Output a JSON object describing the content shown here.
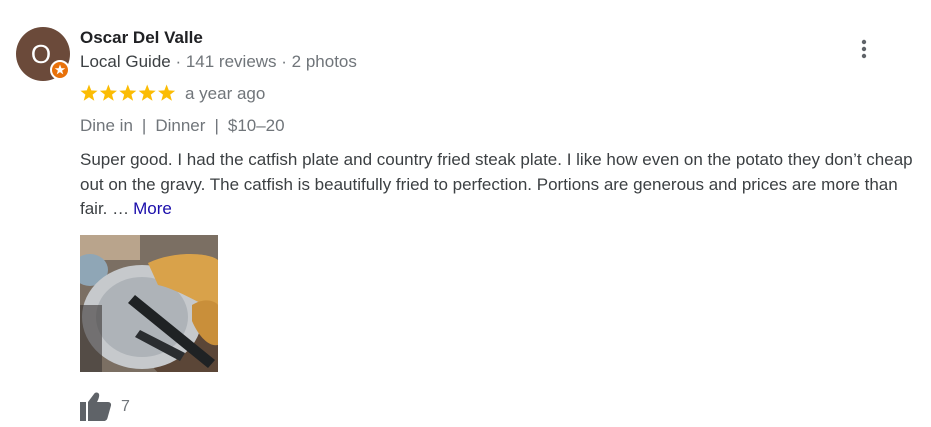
{
  "reviewer": {
    "initial": "O",
    "name": "Oscar Del Valle",
    "guide_label": "Local Guide",
    "reviews": "141 reviews",
    "photos": "2 photos",
    "separator": " · "
  },
  "rating": {
    "stars": 5,
    "max": 5,
    "time_ago": "a year ago"
  },
  "attributes": [
    "Dine in",
    "Dinner",
    "$10–20"
  ],
  "attribute_separator": "|",
  "review": {
    "text": "Super good. I had the catfish plate and country fried steak plate. I like how even on the potato they don’t cheap out on the gravy. The catfish is beautifully fried to perfection. Portions are generous and prices are more than fair. …",
    "more_label": "More"
  },
  "likes": {
    "count": "7"
  },
  "icons": {
    "badge": "local-guide-badge-icon",
    "menu": "more-vert-icon",
    "star": "star-icon",
    "like": "thumb-up-icon"
  },
  "colors": {
    "avatar": "#6b4a3a",
    "badge": "#e8710a",
    "star": "#fbbc04",
    "link": "#1a0dab",
    "meta": "#70757a"
  }
}
